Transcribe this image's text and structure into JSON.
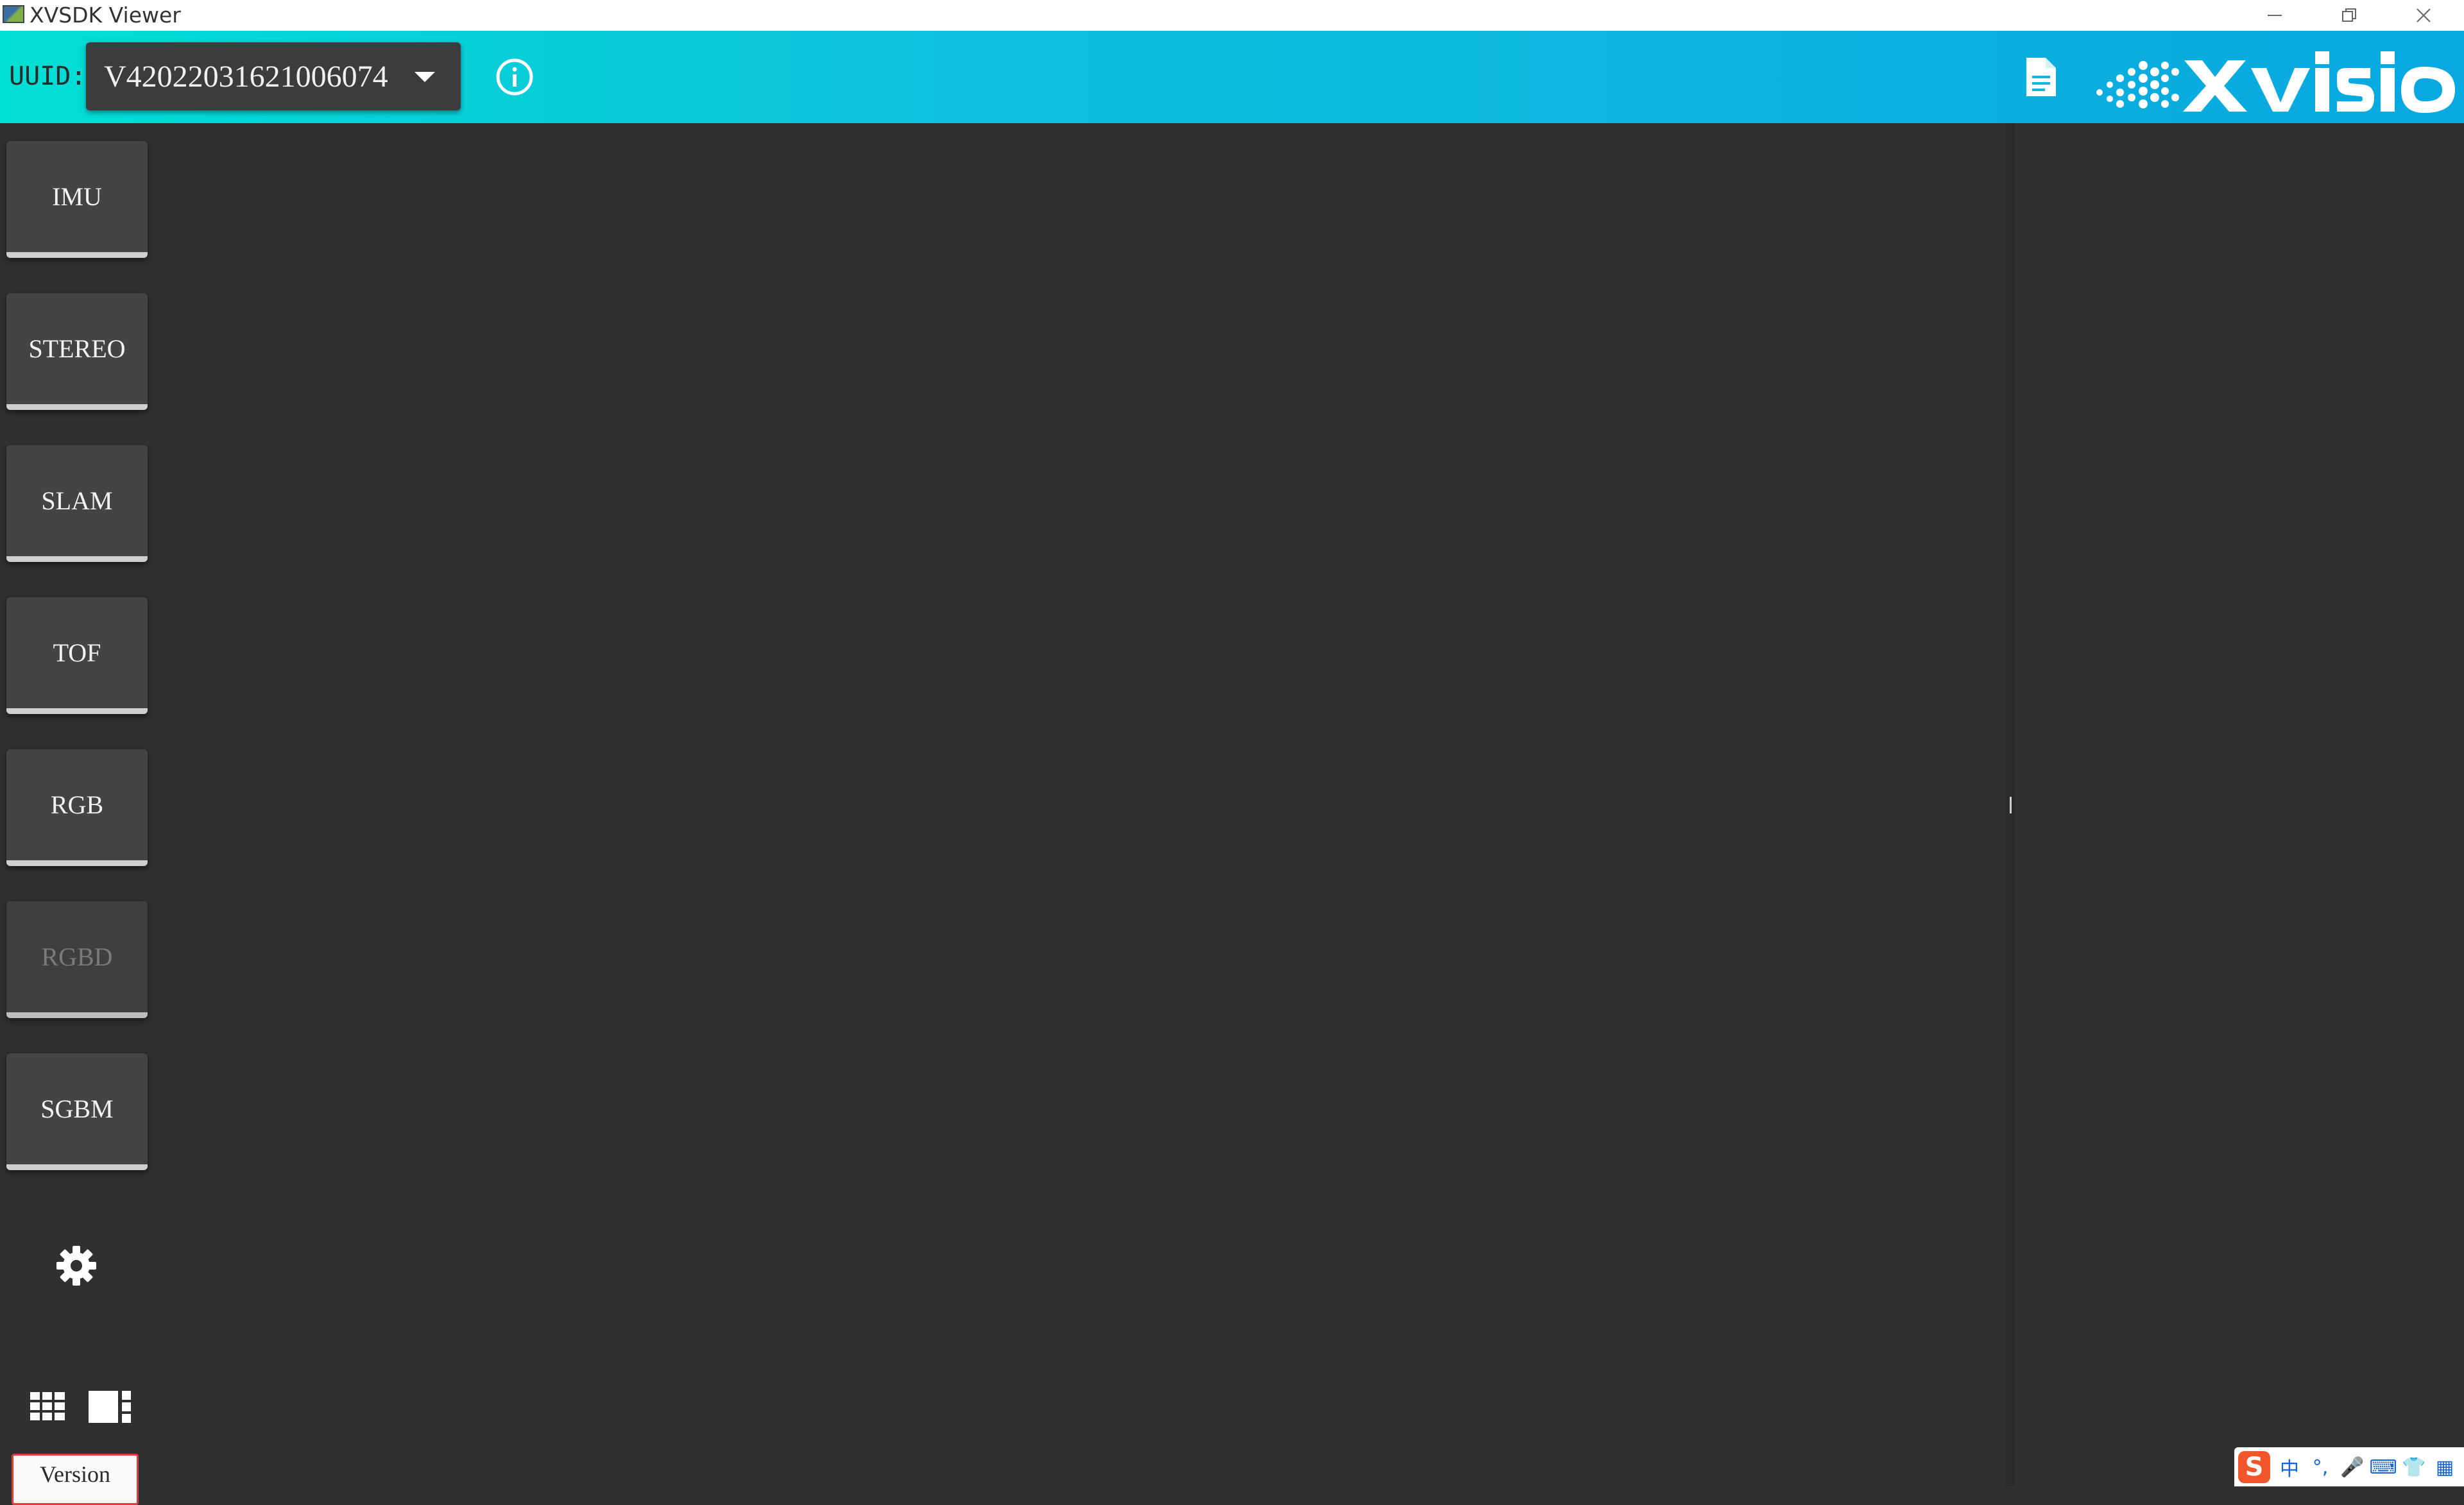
{
  "window": {
    "title": "XVSDK Viewer"
  },
  "header": {
    "uuid_label": "UUID:",
    "uuid_value": "V42022031621006074",
    "logo_text": "XVISIO",
    "accent_colors": [
      "#00dfd5",
      "#08a8e0"
    ]
  },
  "sidebar": {
    "buttons": [
      {
        "label": "IMU",
        "enabled": true
      },
      {
        "label": "STEREO",
        "enabled": true
      },
      {
        "label": "SLAM",
        "enabled": true
      },
      {
        "label": "TOF",
        "enabled": true
      },
      {
        "label": "RGB",
        "enabled": true
      },
      {
        "label": "RGBD",
        "enabled": false
      },
      {
        "label": "SGBM",
        "enabled": true
      }
    ],
    "version_label": "Version"
  },
  "icons": {
    "info": "info-icon",
    "document": "document-icon",
    "settings": "gear-icon",
    "grid_layout": "grid-layout-icon",
    "split_layout": "split-layout-icon"
  },
  "ime": {
    "logo": "S",
    "items": [
      "中",
      "°,",
      "🎤",
      "⌨",
      "👕",
      "▦"
    ]
  }
}
